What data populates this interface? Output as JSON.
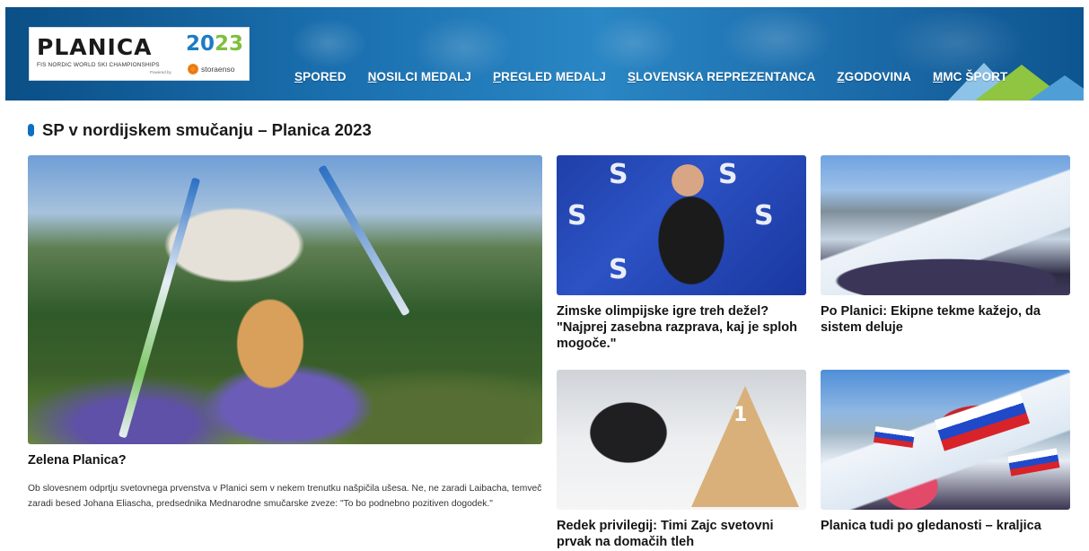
{
  "header": {
    "logo": {
      "wordmark": "PLANICA",
      "year_a": "20",
      "year_b": "23",
      "subtitle": "FIS NORDIC WORLD SKI CHAMPIONSHIPS",
      "powered_by": "Powered by",
      "sponsor": "storaenso"
    },
    "nav": [
      {
        "first": "S",
        "rest": "PORED"
      },
      {
        "first": "N",
        "rest": "OSILCI MEDALJ"
      },
      {
        "first": "P",
        "rest": "REGLED MEDALJ"
      },
      {
        "first": "S",
        "rest": "LOVENSKA REPREZENTANCA"
      },
      {
        "first": "Z",
        "rest": "GODOVINA"
      },
      {
        "first": "M",
        "rest": "MC ŠPORT"
      }
    ]
  },
  "section": {
    "title": "SP v nordijskem smučanju – Planica 2023"
  },
  "articles": {
    "main": {
      "headline": "Zelena Planica?",
      "lead": "Ob slovesnem odprtju svetovnega prvenstva v Planici sem v nekem trenutku našpičila ušesa. Ne, ne zaradi Laibacha, temveč zaradi besed Johana Eliascha, predsednika Mednarodne smučarske zveze: \"To bo podnebno pozitiven dogodek.\""
    },
    "a1": {
      "headline": "Zimske olimpijske igre treh dežel? \"Najprej zasebna razprava, kaj je sploh mogoče.\""
    },
    "a2": {
      "headline": "Po Planici: Ekipne tekme kažejo, da sistem deluje"
    },
    "a3": {
      "headline": "Redek privilegij: Timi Zajc svetovni prvak na domačih tleh"
    },
    "a4": {
      "headline": "Planica tudi po gledanosti – kraljica"
    }
  },
  "image_text": {
    "s_logo": "S",
    "podium_number": "1"
  },
  "colors": {
    "accent": "#0d6fc2",
    "banner": "#1a6fae",
    "logo_year_blue": "#1c7cc4",
    "logo_year_green": "#7fbf3f"
  }
}
